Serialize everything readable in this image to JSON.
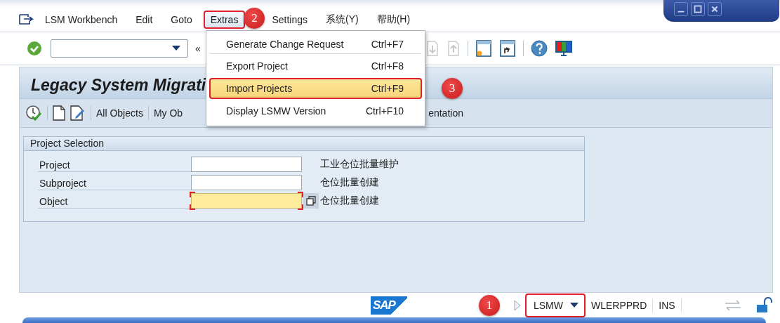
{
  "menu_bar": [
    {
      "label": "LSM Workbench",
      "open": false,
      "annotated": false
    },
    {
      "label": "Edit",
      "open": false,
      "annotated": false
    },
    {
      "label": "Goto",
      "open": false,
      "annotated": false
    },
    {
      "label": "Extras",
      "open": true,
      "annotated": true,
      "badge": "2"
    },
    {
      "label": "Settings",
      "open": false,
      "annotated": false
    },
    {
      "label": "系统(Y)",
      "open": false,
      "annotated": false
    },
    {
      "label": "帮助(H)",
      "open": false,
      "annotated": false
    }
  ],
  "toolbar": {
    "collapse": "«"
  },
  "extras_menu": [
    {
      "label": "Generate Change Request",
      "shortcut": "Ctrl+F7",
      "selected": false,
      "annotated": false
    },
    {
      "label": "Export Project",
      "shortcut": "Ctrl+F8",
      "selected": false,
      "annotated": false
    },
    {
      "label": "Import Projects",
      "shortcut": "Ctrl+F9",
      "selected": true,
      "annotated": true,
      "badge": "3"
    },
    {
      "label": "Display LSMW Version",
      "shortcut": "Ctrl+F10",
      "selected": false,
      "annotated": false
    }
  ],
  "app": {
    "title": "Legacy System Migrati",
    "toolbar": [
      "All Objects",
      "My Ob",
      "entation"
    ],
    "selection": {
      "title": "Project Selection",
      "fields": [
        {
          "label": "Project",
          "description": "工业仓位批量维护",
          "required": false,
          "focused": false,
          "value_help": false
        },
        {
          "label": "Subproject",
          "description": "仓位批量创建",
          "required": false,
          "focused": false,
          "value_help": false
        },
        {
          "label": "Object",
          "description": "仓位批量创建",
          "required": true,
          "focused": true,
          "value_help": true
        }
      ]
    }
  },
  "status_bar": {
    "logo": "SAP",
    "transaction": "LSMW",
    "annotated": true,
    "badge": "1",
    "system": "WLERPPRD",
    "mode": "INS"
  }
}
